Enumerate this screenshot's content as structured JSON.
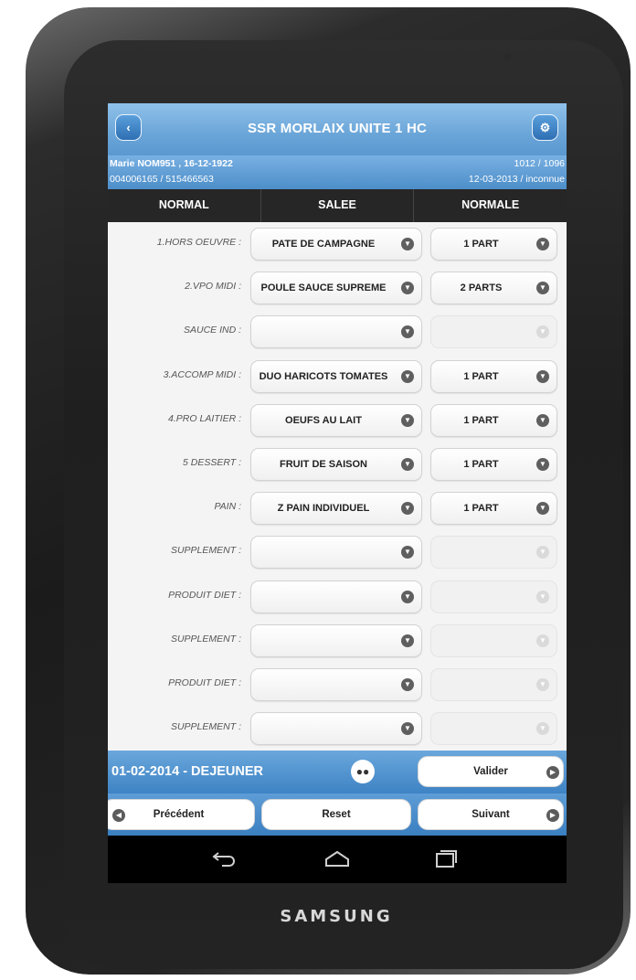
{
  "device": {
    "brand": "SAMSUNG"
  },
  "header": {
    "title": "SSR MORLAIX UNITE 1 HC",
    "back_icon": "chevron-left-icon",
    "settings_icon": "gear-icon"
  },
  "patient": {
    "name_line": "Marie NOM951 , 16-12-1922",
    "ids": "004006165 / 515466563",
    "room": "1012 / 1096",
    "date_status": "12-03-2013 / inconnue"
  },
  "columns": [
    "NORMAL",
    "SALEE",
    "NORMALE"
  ],
  "rows": [
    {
      "label": "1.HORS OEUVRE :",
      "item": "PATE DE CAMPAGNE",
      "portion": "1 PART",
      "portion_enabled": true
    },
    {
      "label": "2.VPO MIDI :",
      "item": "POULE SAUCE SUPREME",
      "portion": "2 PARTS",
      "portion_enabled": true
    },
    {
      "label": "SAUCE IND :",
      "item": "",
      "portion": "",
      "portion_enabled": false
    },
    {
      "label": "3.ACCOMP MIDI :",
      "item": "DUO HARICOTS TOMATES",
      "portion": "1 PART",
      "portion_enabled": true
    },
    {
      "label": "4.PRO LAITIER :",
      "item": "OEUFS AU LAIT",
      "portion": "1 PART",
      "portion_enabled": true
    },
    {
      "label": "5 DESSERT :",
      "item": "FRUIT DE SAISON",
      "portion": "1 PART",
      "portion_enabled": true
    },
    {
      "label": "PAIN :",
      "item": "Z PAIN INDIVIDUEL",
      "portion": "1 PART",
      "portion_enabled": true
    },
    {
      "label": "SUPPLEMENT :",
      "item": "",
      "portion": "",
      "portion_enabled": false
    },
    {
      "label": "PRODUIT DIET :",
      "item": "",
      "portion": "",
      "portion_enabled": false
    },
    {
      "label": "SUPPLEMENT :",
      "item": "",
      "portion": "",
      "portion_enabled": false
    },
    {
      "label": "PRODUIT DIET :",
      "item": "",
      "portion": "",
      "portion_enabled": false
    },
    {
      "label": "SUPPLEMENT :",
      "item": "",
      "portion": "",
      "portion_enabled": false
    }
  ],
  "footer": {
    "date_meal": "01-02-2014  -  DEJEUNER",
    "people_icon": "users-icon",
    "validate_label": "Valider",
    "prev_label": "Précédent",
    "reset_label": "Reset",
    "next_label": "Suivant"
  },
  "android_nav": [
    "back-icon",
    "home-icon",
    "recent-apps-icon"
  ]
}
